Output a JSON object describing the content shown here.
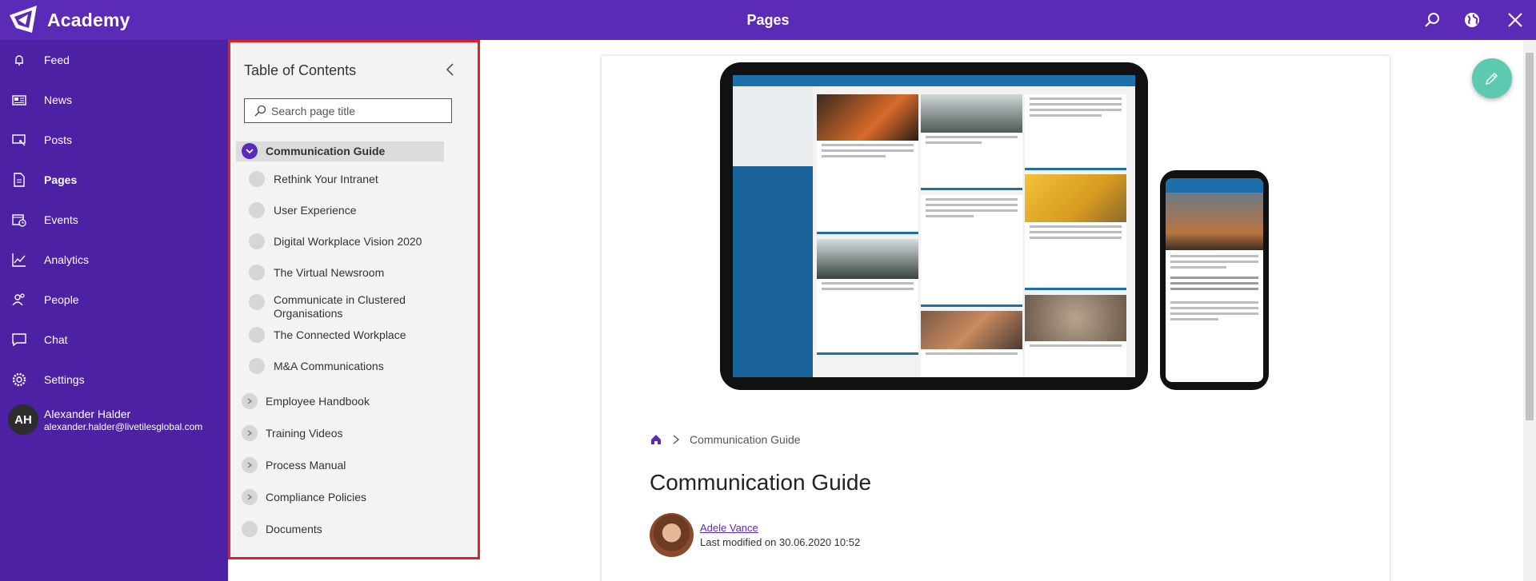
{
  "app": {
    "brand": "Academy",
    "page_title": "Pages"
  },
  "topbar_icons": [
    "search-icon",
    "globe-icon",
    "close-icon"
  ],
  "nav": {
    "items": [
      {
        "label": "Feed",
        "icon": "bell-icon"
      },
      {
        "label": "News",
        "icon": "news-icon"
      },
      {
        "label": "Posts",
        "icon": "posts-icon"
      },
      {
        "label": "Pages",
        "icon": "page-icon",
        "active": true
      },
      {
        "label": "Events",
        "icon": "calendar-icon"
      },
      {
        "label": "Analytics",
        "icon": "analytics-icon"
      },
      {
        "label": "People",
        "icon": "people-icon"
      },
      {
        "label": "Chat",
        "icon": "chat-icon"
      },
      {
        "label": "Settings",
        "icon": "gear-icon"
      }
    ],
    "user": {
      "initials": "AH",
      "name": "Alexander Halder",
      "email": "alexander.halder@livetilesglobal.com"
    }
  },
  "toc": {
    "title": "Table of Contents",
    "search_placeholder": "Search page title",
    "items": [
      {
        "label": "Communication Guide",
        "state": "expanded",
        "selected": true
      },
      {
        "label": "Rethink Your Intranet",
        "state": "leaf",
        "child": true
      },
      {
        "label": "User Experience",
        "state": "leaf",
        "child": true
      },
      {
        "label": "Digital Workplace Vision 2020",
        "state": "leaf",
        "child": true
      },
      {
        "label": "The Virtual Newsroom",
        "state": "leaf",
        "child": true
      },
      {
        "label": "Communicate in Clustered Organisations",
        "state": "leaf",
        "child": true
      },
      {
        "label": "The Connected Workplace",
        "state": "leaf",
        "child": true
      },
      {
        "label": "M&A Communications",
        "state": "leaf",
        "child": true
      },
      {
        "label": "Employee Handbook",
        "state": "collapsed"
      },
      {
        "label": "Training Videos",
        "state": "collapsed"
      },
      {
        "label": "Process Manual",
        "state": "collapsed"
      },
      {
        "label": "Compliance Policies",
        "state": "collapsed"
      },
      {
        "label": "Documents",
        "state": "leaf"
      }
    ]
  },
  "page": {
    "breadcrumb": "Communication Guide",
    "heading": "Communication Guide",
    "author": "Adele Vance",
    "modified": "Last modified on 30.06.2020 10:52"
  },
  "colors": {
    "brand": "#5b2ab7",
    "nav_bg": "#4c21a4",
    "fab": "#5cc9b0",
    "highlight_border": "#e02121"
  }
}
